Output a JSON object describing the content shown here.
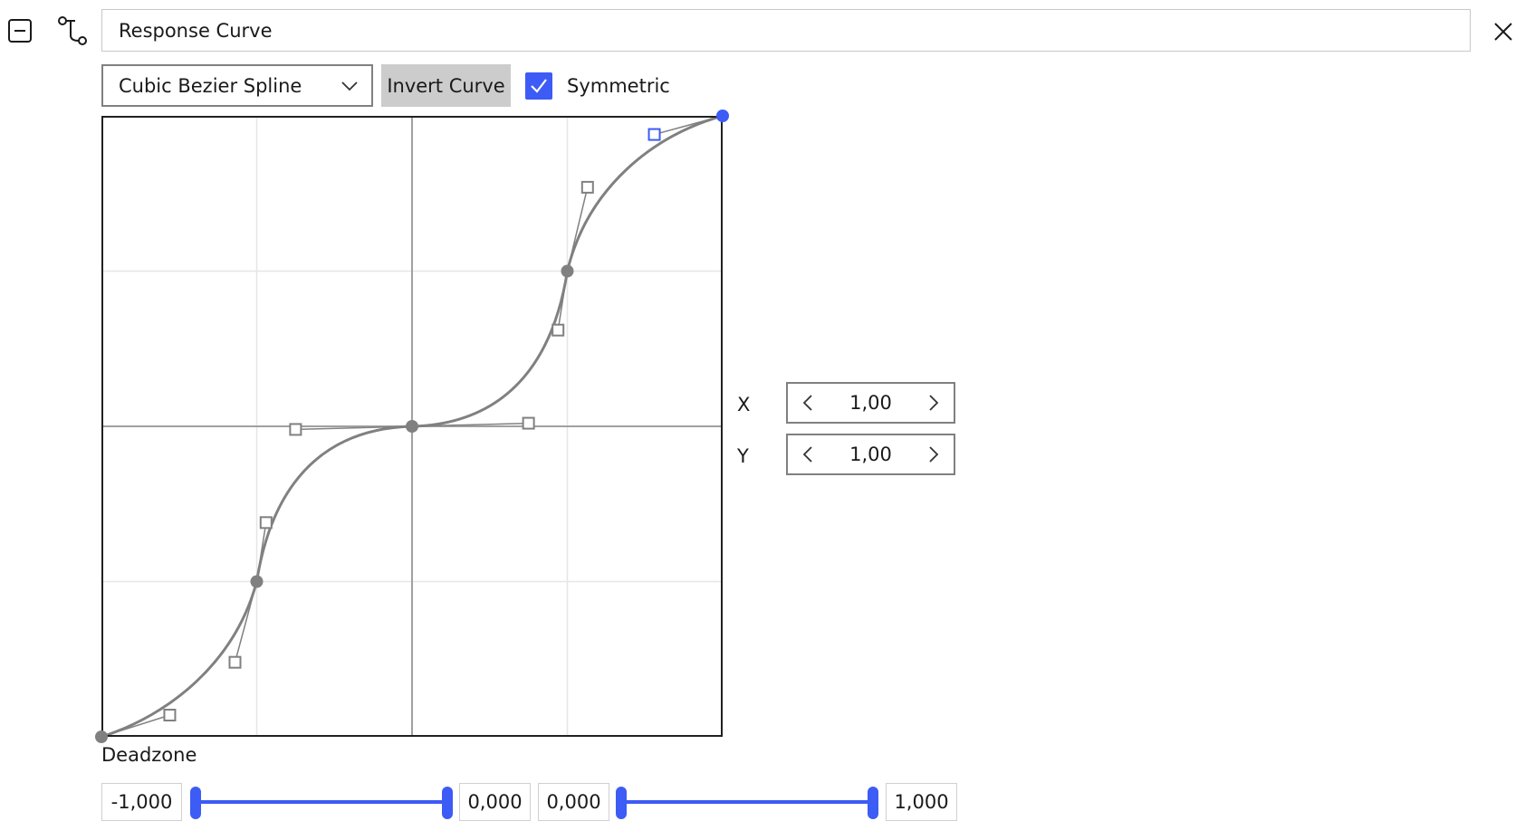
{
  "header": {
    "title_value": "Response Curve",
    "icons": [
      "collapse-icon",
      "curve-tool-icon",
      "close-icon"
    ]
  },
  "toolbar": {
    "curve_type": "Cubic Bezier Spline",
    "invert_label": "Invert Curve",
    "symmetric_label": "Symmetric",
    "symmetric_checked": true
  },
  "point_editor": {
    "x_label": "X",
    "y_label": "Y",
    "x_value": "1,00",
    "y_value": "1,00"
  },
  "deadzone": {
    "label": "Deadzone",
    "low_min": "-1,000",
    "low_max": "0,000",
    "high_min": "0,000",
    "high_max": "1,000"
  },
  "curve": {
    "x_range": [
      -1,
      1
    ],
    "y_range": [
      -1,
      1
    ],
    "points": [
      {
        "x": -1.0,
        "y": -1.0
      },
      {
        "x": -0.5,
        "y": -0.5
      },
      {
        "x": 0.0,
        "y": 0.0
      },
      {
        "x": 0.5,
        "y": 0.5
      },
      {
        "x": 1.0,
        "y": 1.0,
        "selected": true
      }
    ],
    "handles": [
      {
        "x": -0.78,
        "y": -0.93
      },
      {
        "x": -0.57,
        "y": -0.76
      },
      {
        "x": -0.47,
        "y": -0.31
      },
      {
        "x": -0.375,
        "y": -0.01
      },
      {
        "x": 0.375,
        "y": 0.01
      },
      {
        "x": 0.47,
        "y": 0.31
      },
      {
        "x": 0.565,
        "y": 0.77
      },
      {
        "x": 0.78,
        "y": 0.94,
        "selected": true
      }
    ],
    "colors": {
      "curve": "#808080",
      "accent": "#3d5bf5",
      "grid": "#e6e6e6",
      "axis": "#a0a0a0",
      "border": "#202020"
    }
  }
}
